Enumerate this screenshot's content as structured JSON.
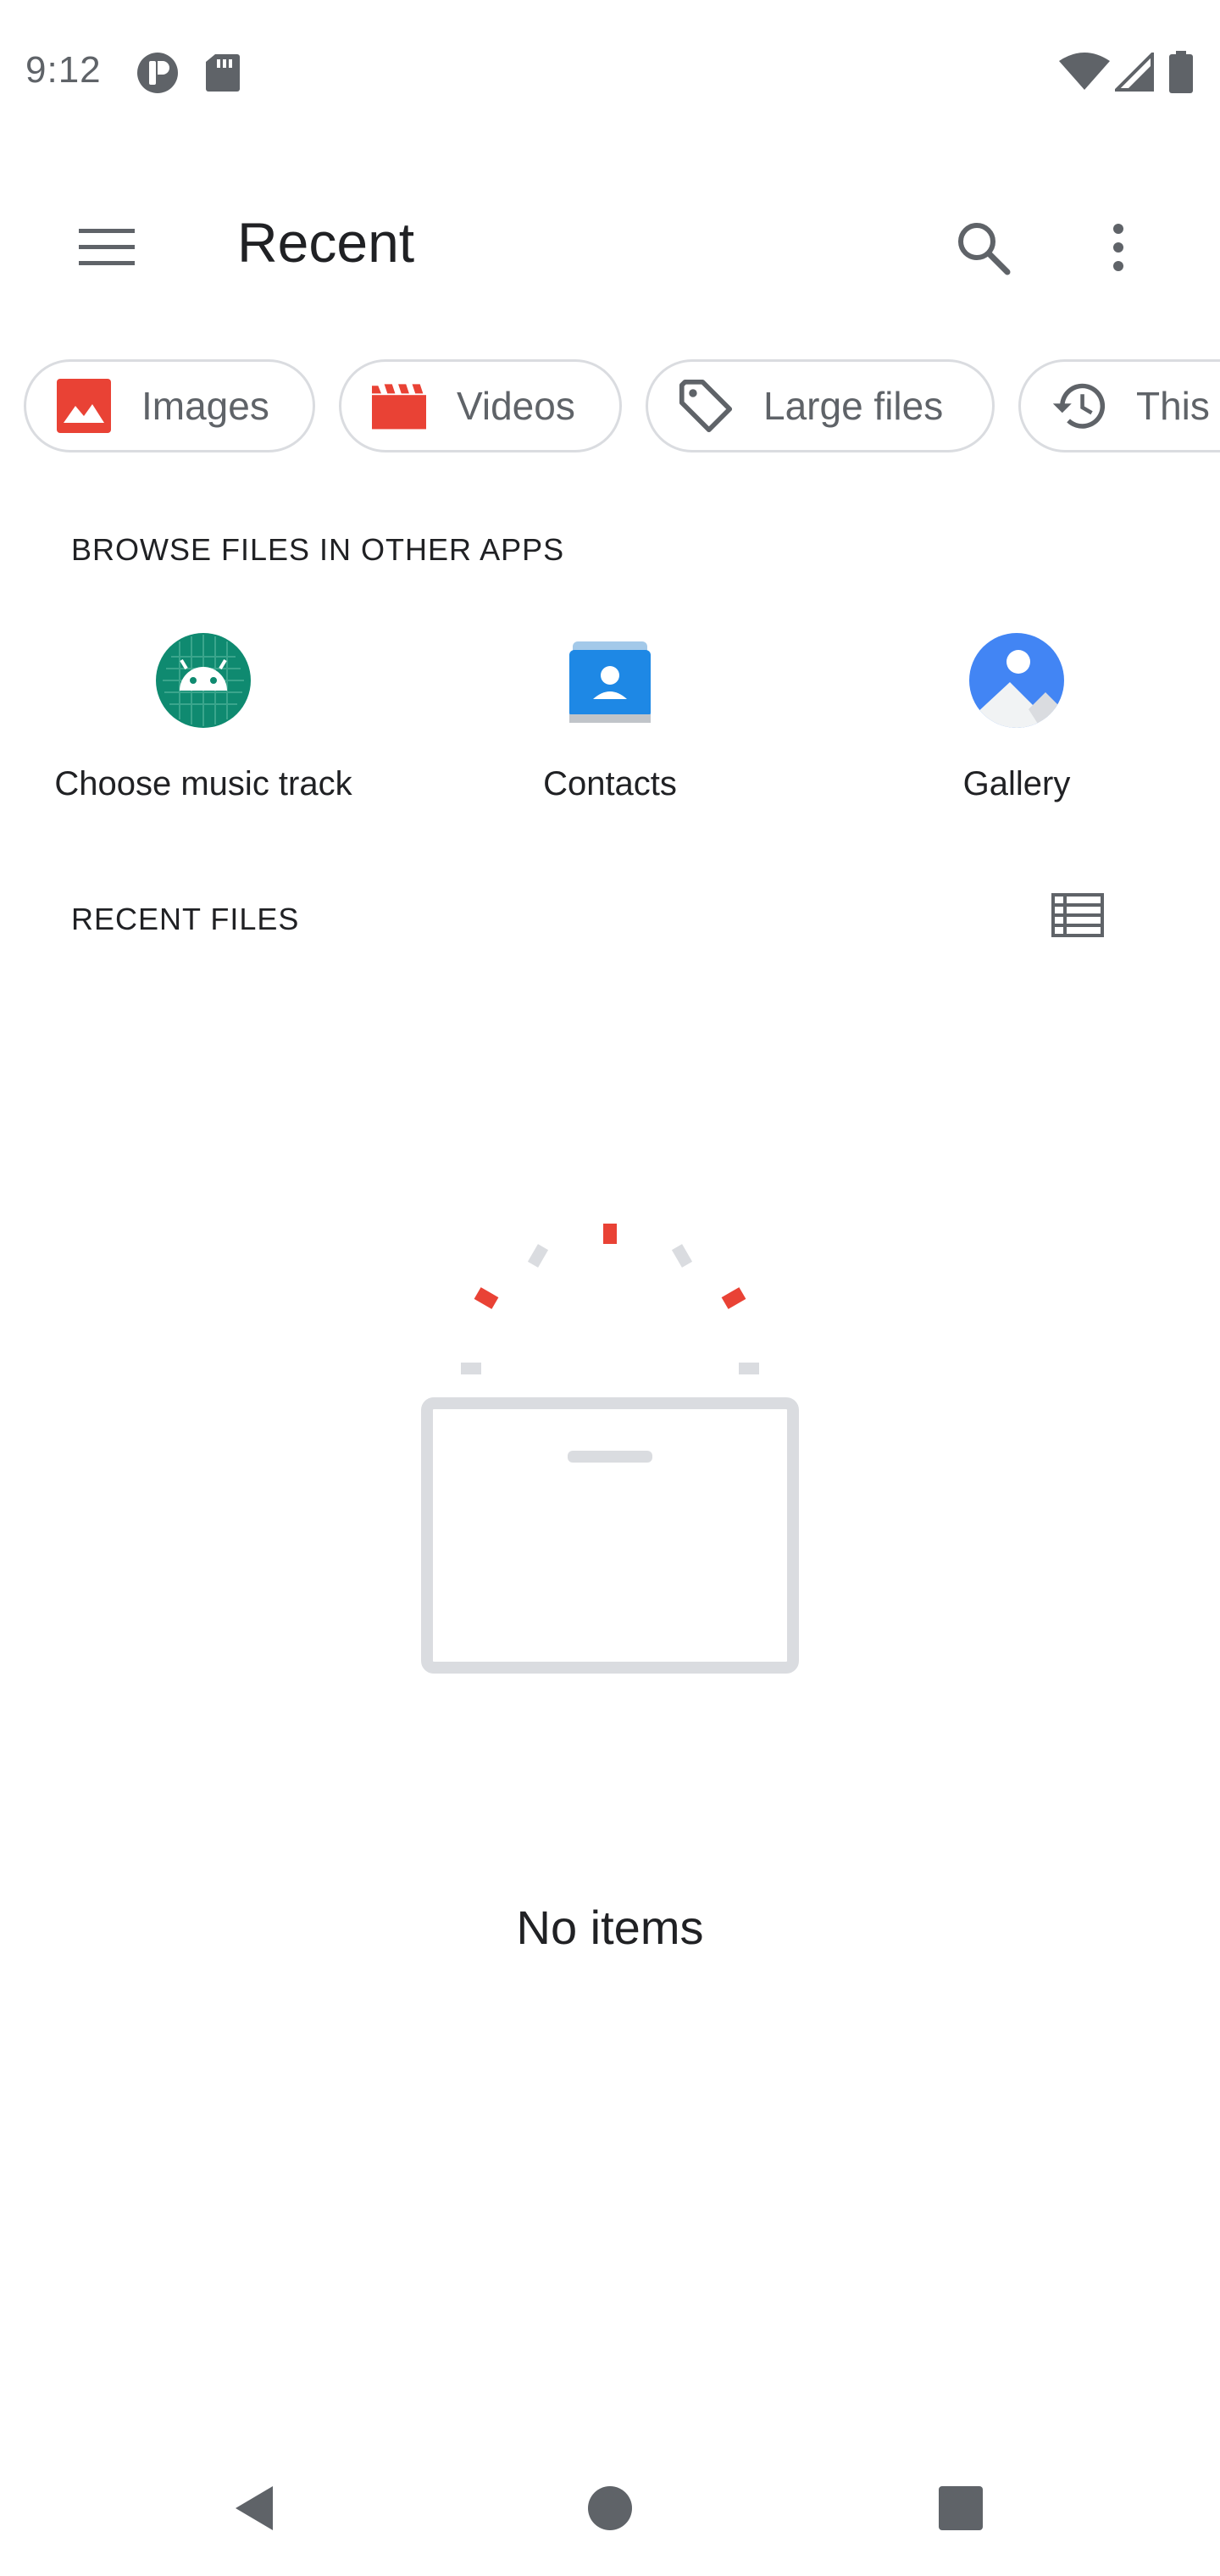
{
  "status_bar": {
    "time": "9:12",
    "icons": [
      "notification-icon",
      "sd-card-icon",
      "wifi-icon",
      "signal-icon",
      "battery-icon"
    ]
  },
  "toolbar": {
    "title": "Recent",
    "menu_icon": "hamburger-menu-icon",
    "search_icon": "search-icon",
    "more_icon": "more-vert-icon"
  },
  "chips": [
    {
      "label": "Images",
      "icon": "image-icon",
      "color": "#e94235"
    },
    {
      "label": "Videos",
      "icon": "movie-icon",
      "color": "#e94235"
    },
    {
      "label": "Large files",
      "icon": "tag-icon",
      "color": "#5f6368"
    },
    {
      "label": "This",
      "icon": "history-icon",
      "color": "#5f6368"
    }
  ],
  "browse_section": {
    "header": "BROWSE FILES IN OTHER APPS",
    "apps": [
      {
        "label": "Choose music track",
        "icon": "android-app-icon"
      },
      {
        "label": "Contacts",
        "icon": "contacts-app-icon"
      },
      {
        "label": "Gallery",
        "icon": "gallery-app-icon"
      }
    ]
  },
  "recent_section": {
    "header": "RECENT FILES",
    "view_toggle_icon": "list-view-icon"
  },
  "empty_state": {
    "text": "No items",
    "illustration": "empty-box-illustration"
  },
  "nav_bar": {
    "back_icon": "back-icon",
    "home_icon": "home-icon",
    "recents_icon": "recents-icon"
  },
  "colors": {
    "accent_red": "#e94235",
    "chip_border": "#dadce0",
    "secondary_text": "#5f6368"
  }
}
